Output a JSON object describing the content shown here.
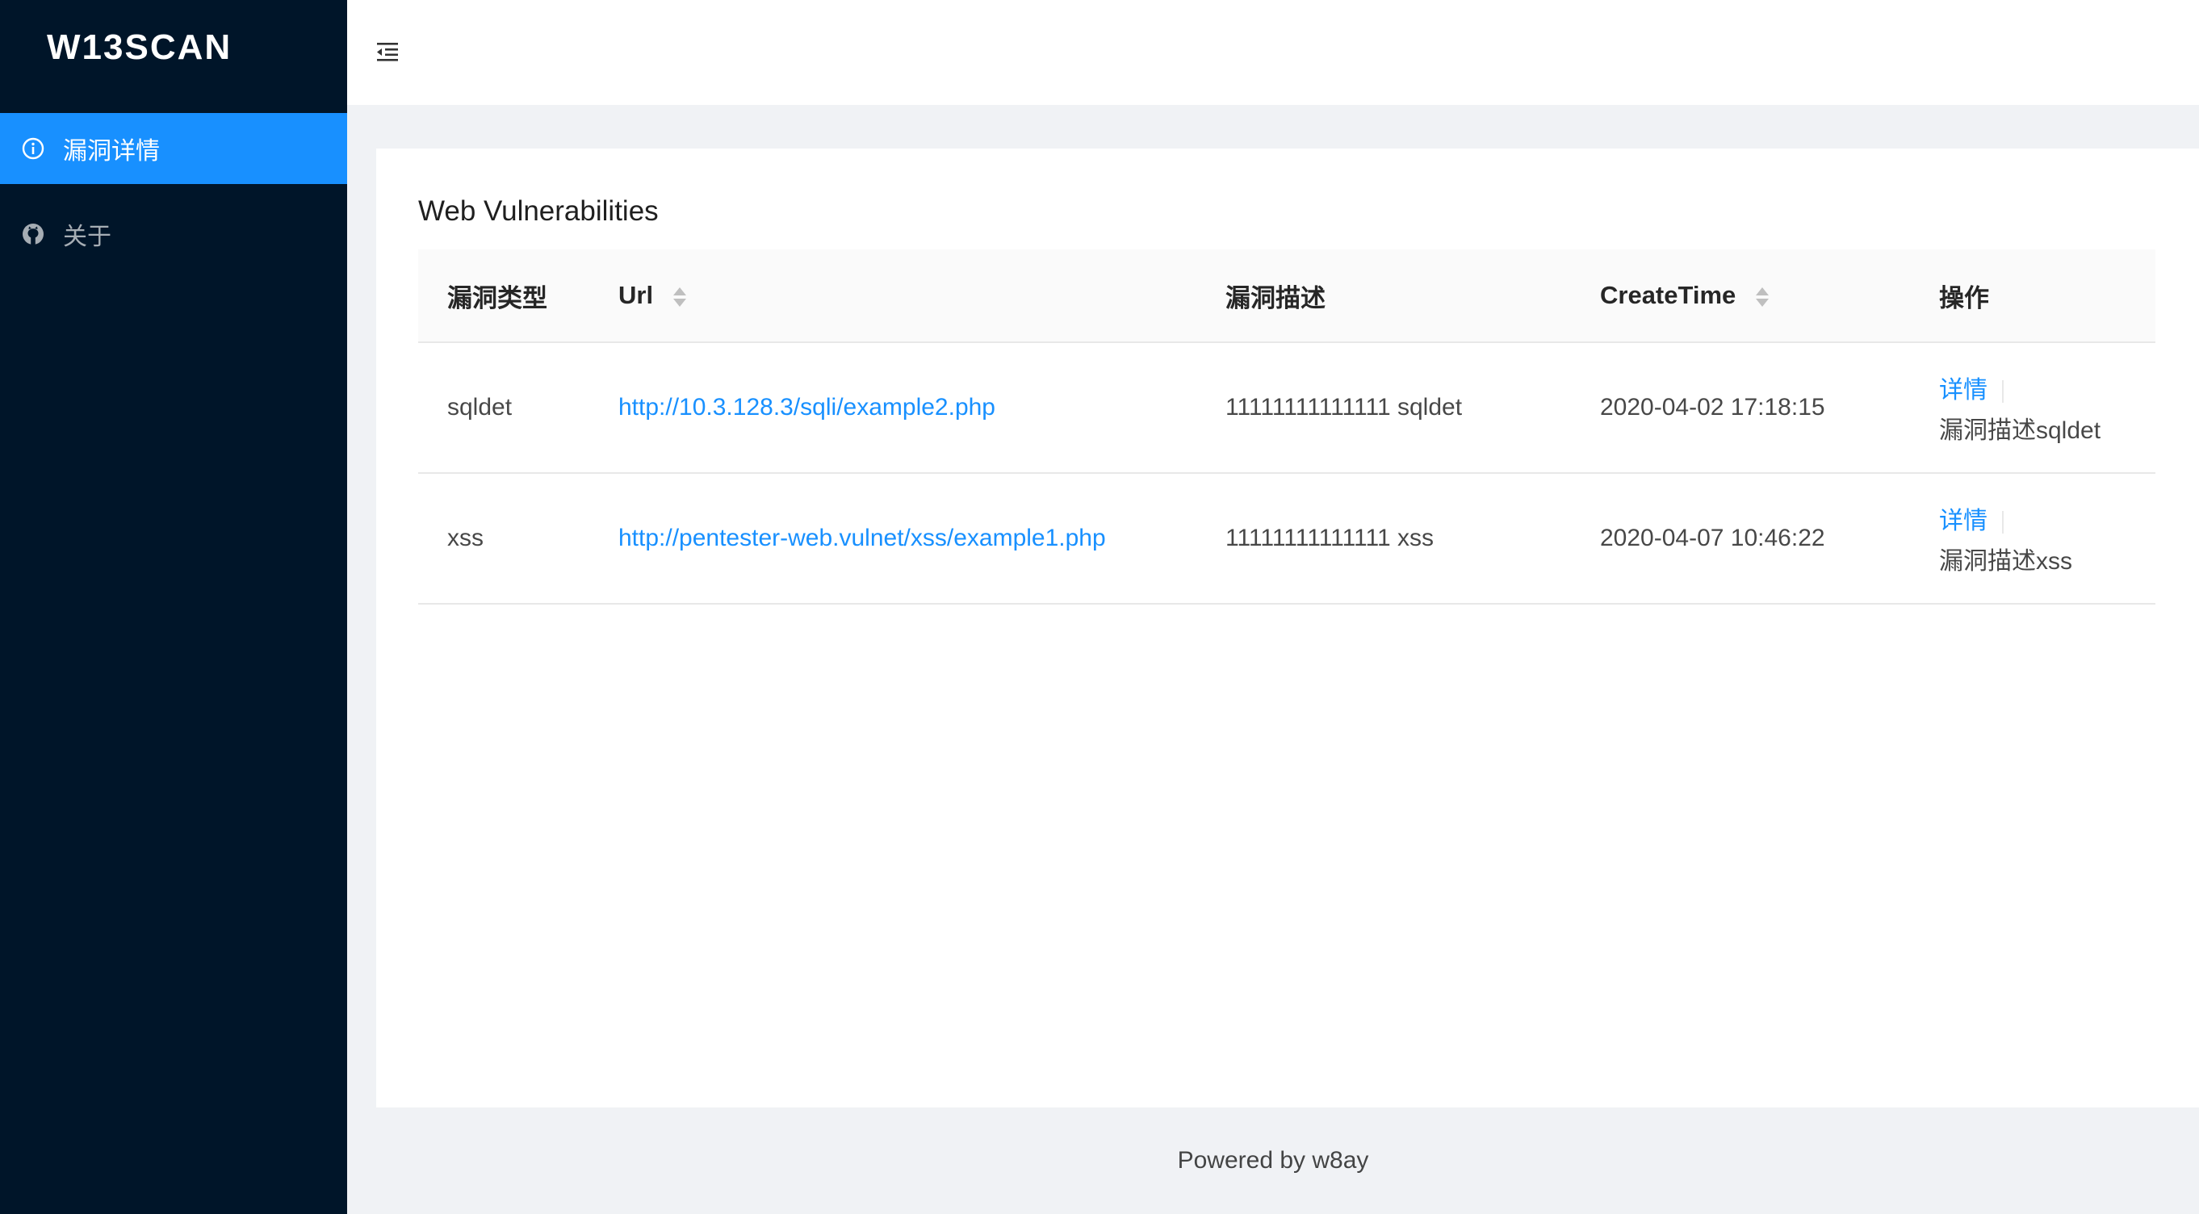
{
  "app": {
    "logo": "W13SCAN"
  },
  "sidebar": {
    "items": [
      {
        "label": "漏洞详情",
        "icon": "info-circle-icon",
        "active": true
      },
      {
        "label": "关于",
        "icon": "github-icon",
        "active": false
      }
    ]
  },
  "header": {
    "toggle_icon": "menu-fold-icon"
  },
  "main": {
    "title": "Web Vulnerabilities",
    "columns": [
      "漏洞类型",
      "Url",
      "漏洞描述",
      "CreateTime",
      "操作"
    ],
    "rows": [
      {
        "type": "sqldet",
        "url": "http://10.3.128.3/sqli/example2.php",
        "desc": "11111111111111 sqldet",
        "time": "2020-04-02 17:18:15",
        "action": "详情",
        "action_desc": "漏洞描述sqldet"
      },
      {
        "type": "xss",
        "url": "http://pentester-web.vulnet/xss/example1.php",
        "desc": "11111111111111 xss",
        "time": "2020-04-07 10:46:22",
        "action": "详情",
        "action_desc": "漏洞描述xss"
      }
    ]
  },
  "footer": {
    "text": "Powered by w8ay"
  },
  "colors": {
    "sider": "#001529",
    "accent": "#1890ff",
    "background": "#f0f2f5"
  }
}
